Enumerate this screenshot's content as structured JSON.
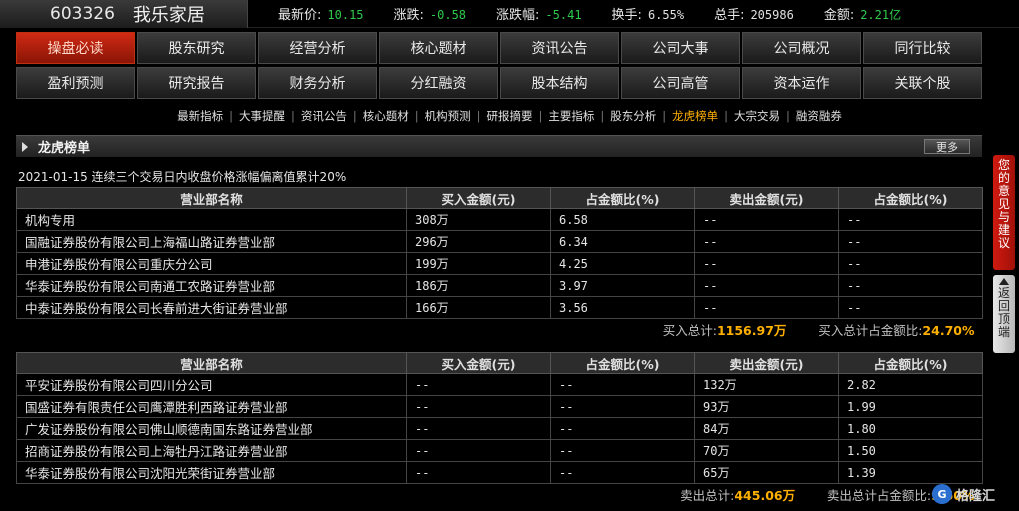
{
  "quote": {
    "code": "603326",
    "name": "我乐家居",
    "items": [
      {
        "label": "最新价:",
        "value": "10.15",
        "color": "green"
      },
      {
        "label": "涨跌:",
        "value": "-0.58",
        "color": "green"
      },
      {
        "label": "涨跌幅:",
        "value": "-5.41",
        "color": "green"
      },
      {
        "label": "换手:",
        "value": "6.55%",
        "color": "white"
      },
      {
        "label": "总手:",
        "value": "205986",
        "color": "white"
      },
      {
        "label": "金额:",
        "value": "2.21亿",
        "color": "green"
      }
    ]
  },
  "nav": {
    "row1": [
      "操盘必读",
      "股东研究",
      "经营分析",
      "核心题材",
      "资讯公告",
      "公司大事",
      "公司概况",
      "同行比较"
    ],
    "row2": [
      "盈利预测",
      "研究报告",
      "财务分析",
      "分红融资",
      "股本结构",
      "公司高管",
      "资本运作",
      "关联个股"
    ]
  },
  "sublinks": [
    "最新指标",
    "大事提醒",
    "资讯公告",
    "核心题材",
    "机构预测",
    "研报摘要",
    "主要指标",
    "股东分析",
    "龙虎榜单",
    "大宗交易",
    "融资融券"
  ],
  "section": {
    "title": "龙虎榜单",
    "more": "更多"
  },
  "date_line": "2021-01-15 连续三个交易日内收盘价格涨幅偏离值累计20%",
  "columns": [
    "营业部名称",
    "买入金额(元)",
    "占金额比(%)",
    "卖出金额(元)",
    "占金额比(%)"
  ],
  "buy_table": {
    "rows": [
      [
        "机构专用",
        "308万",
        "6.58",
        "--",
        "--"
      ],
      [
        "国融证券股份有限公司上海福山路证券营业部",
        "296万",
        "6.34",
        "--",
        "--"
      ],
      [
        "申港证券股份有限公司重庆分公司",
        "199万",
        "4.25",
        "--",
        "--"
      ],
      [
        "华泰证券股份有限公司南通工农路证券营业部",
        "186万",
        "3.97",
        "--",
        "--"
      ],
      [
        "中泰证券股份有限公司长春前进大街证券营业部",
        "166万",
        "3.56",
        "--",
        "--"
      ]
    ],
    "total_label": "买入总计:",
    "total_value": "1156.97万",
    "ratio_label": "买入总计占金额比:",
    "ratio_value": "24.70%"
  },
  "sell_table": {
    "rows": [
      [
        "平安证券股份有限公司四川分公司",
        "--",
        "--",
        "132万",
        "2.82"
      ],
      [
        "国盛证券有限责任公司鹰潭胜利西路证券营业部",
        "--",
        "--",
        "93万",
        "1.99"
      ],
      [
        "广发证券股份有限公司佛山顺德南国东路证券营业部",
        "--",
        "--",
        "84万",
        "1.80"
      ],
      [
        "招商证券股份有限公司上海牡丹江路证券营业部",
        "--",
        "--",
        "70万",
        "1.50"
      ],
      [
        "华泰证券股份有限公司沈阳光荣街证券营业部",
        "--",
        "--",
        "65万",
        "1.39"
      ]
    ],
    "total_label": "卖出总计:",
    "total_value": "445.06万",
    "ratio_label": "卖出总计占金额比:",
    "ratio_value": "9.50%"
  },
  "side": {
    "feedback": [
      "您",
      "的",
      "意",
      "见",
      "与",
      "建",
      "议"
    ],
    "back_top": [
      "返",
      "回",
      "顶",
      "端"
    ]
  },
  "watermark": "格隆汇",
  "colors": {
    "accent_red": "#d02a14",
    "down_green": "#2ec94a",
    "highlight": "#ffb000"
  }
}
